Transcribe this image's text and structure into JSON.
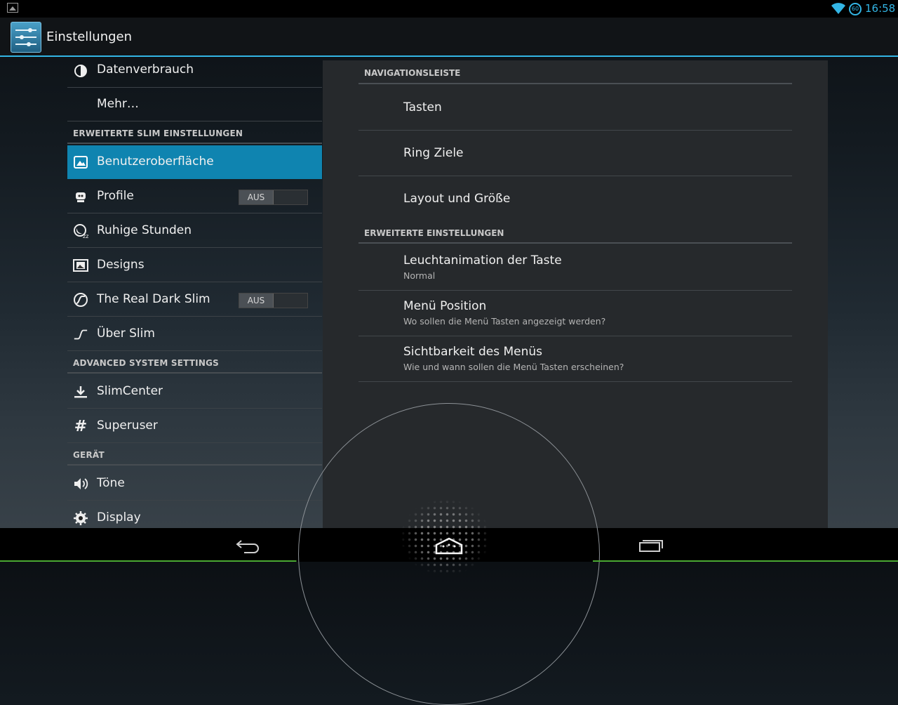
{
  "status_bar": {
    "time": "16:58",
    "battery_label": "60"
  },
  "action_bar": {
    "title": "Einstellungen"
  },
  "left_list": {
    "items_top": [
      {
        "label": "Datenverbrauch",
        "icon": "data-usage-icon"
      },
      {
        "label": "Mehr…",
        "icon": ""
      }
    ],
    "section_slim": "ERWEITERTE SLIM EINSTELLUNGEN",
    "items_slim": [
      {
        "label": "Benutzeroberfläche",
        "icon": "interface-icon",
        "selected": true
      },
      {
        "label": "Profile",
        "icon": "profile-icon",
        "toggle": "AUS"
      },
      {
        "label": "Ruhige Stunden",
        "icon": "quiet-hours-icon"
      },
      {
        "label": "Designs",
        "icon": "themes-icon"
      },
      {
        "label": "The Real Dark Slim",
        "icon": "dark-slim-icon",
        "toggle": "AUS"
      },
      {
        "label": "Über Slim",
        "icon": "slim-logo-icon"
      }
    ],
    "section_advanced": "ADVANCED SYSTEM SETTINGS",
    "items_advanced": [
      {
        "label": "SlimCenter",
        "icon": "download-icon"
      },
      {
        "label": "Superuser",
        "icon": "hash-icon"
      }
    ],
    "section_device": "GERÄT",
    "items_device": [
      {
        "label": "Töne",
        "icon": "volume-icon"
      },
      {
        "label": "Display",
        "icon": "brightness-icon"
      }
    ]
  },
  "right_panel": {
    "section_nav": "NAVIGATIONSLEISTE",
    "nav_items": [
      {
        "title": "Tasten"
      },
      {
        "title": "Ring Ziele"
      },
      {
        "title": "Layout und Größe"
      }
    ],
    "section_advanced": "ERWEITERTE EINSTELLUNGEN",
    "advanced_items": [
      {
        "title": "Leuchtanimation der Taste",
        "subtitle": "Normal"
      },
      {
        "title": "Menü Position",
        "subtitle": "Wo sollen die Menü Tasten angezeigt werden?"
      },
      {
        "title": "Sichtbarkeit des Menüs",
        "subtitle": "Wie und wann sollen die Menü Tasten erscheinen?"
      }
    ]
  },
  "colors": {
    "accent": "#33b5e5",
    "selected": "#0f84b0"
  }
}
